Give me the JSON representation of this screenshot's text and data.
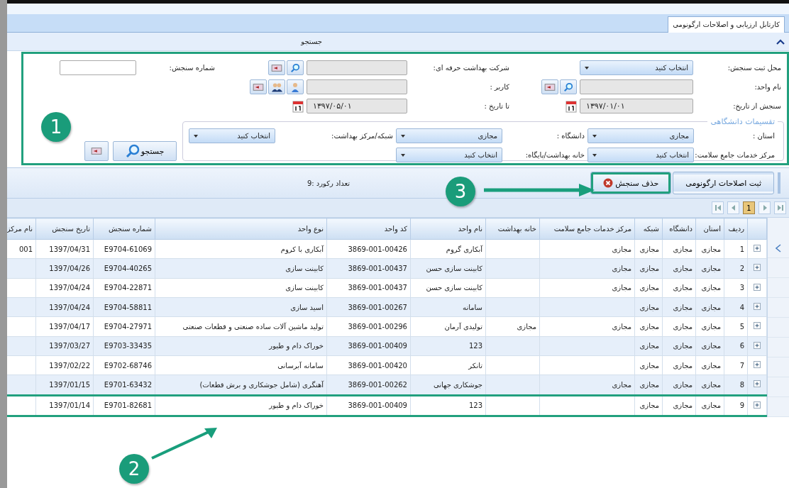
{
  "tab": {
    "label": "کارتابل ارزیابی و اصلاحات ارگونومی",
    "selected": true
  },
  "search_panel": {
    "title": "جستجو",
    "expanded": true,
    "outlined": true,
    "fields": [
      {
        "kind": "select",
        "label": "محل ثبت سنجش:",
        "value": "انتخاب کنید"
      },
      {
        "kind": "lookup",
        "label": "شرکت بهداشت حرفه ای:"
      },
      {
        "kind": "text",
        "label": "شماره سنجش:"
      },
      {
        "kind": "lookup",
        "label": "نام واحد:"
      },
      {
        "kind": "user",
        "label": "کاربر :"
      },
      {
        "kind": "empty"
      },
      {
        "kind": "date",
        "label": "سنجش از تاریخ:",
        "value": "۱۳۹۷/۰۱/۰۱"
      },
      {
        "kind": "date",
        "label": "تا تاریخ :",
        "value": "۱۳۹۷/۰۵/۰۱"
      }
    ],
    "division": {
      "title": "تقسیمات دانشگاهی",
      "fields": [
        {
          "label": "استان :",
          "value": "مجازی"
        },
        {
          "label": "دانشگاه :",
          "value": "مجازی"
        },
        {
          "label": "شبکه/مرکز بهداشت:",
          "value": "انتخاب کنید"
        },
        {
          "label": "مرکز خدمات جامع سلامت:",
          "value": "انتخاب کنید"
        },
        {
          "label": "خانه بهداشت/پایگاه:",
          "value": "انتخاب کنید"
        }
      ]
    },
    "search_button": "جستجو"
  },
  "toolbar": {
    "buttons": [
      {
        "label": "ثبت اصلاحات ارگونومی",
        "kind": "plain",
        "outlined": false
      },
      {
        "label": "حذف سنجش",
        "kind": "delete",
        "outlined": true
      }
    ],
    "record_count": "تعداد رکورد :9"
  },
  "pager": {
    "pages": [
      {
        "label": "1",
        "selected": true
      }
    ]
  },
  "table": {
    "columns": [
      "ردیف",
      "استان",
      "دانشگاه",
      "شبکه",
      "مرکز خدمات جامع سلامت",
      "خانه بهداشت",
      "نام واحد",
      "کد واحد",
      "نوع واحد",
      "شماره سنجش",
      "تاریخ سنجش",
      "نام مرکز"
    ],
    "rows": [
      {
        "current": true,
        "outlined": false,
        "cells": [
          "1",
          "مجازی",
          "مجازی",
          "مجازی",
          "مجازی",
          null,
          "آبکاری گروم",
          "3869-001-00426",
          "آبکاری با کروم",
          "E9704-61069",
          "1397/04/31",
          "001"
        ]
      },
      {
        "current": false,
        "outlined": false,
        "cells": [
          "2",
          "مجازی",
          "مجازی",
          "مجازی",
          "مجازی",
          null,
          "کابینت سازی حسن",
          "3869-001-00437",
          "کابینت سازی",
          "E9704-40265",
          "1397/04/26",
          null
        ]
      },
      {
        "current": false,
        "outlined": false,
        "cells": [
          "3",
          "مجازی",
          "مجازی",
          "مجازی",
          "مجازی",
          null,
          "کابینت سازی حسن",
          "3869-001-00437",
          "کابینت سازی",
          "E9704-22871",
          "1397/04/24",
          null
        ]
      },
      {
        "current": false,
        "outlined": false,
        "cells": [
          "4",
          "مجازی",
          "مجازی",
          "مجازی",
          null,
          null,
          "سامانه",
          "3869-001-00267",
          "اسید سازی",
          "E9704-58811",
          "1397/04/24",
          null
        ]
      },
      {
        "current": false,
        "outlined": false,
        "cells": [
          "5",
          "مجازی",
          "مجازی",
          "مجازی",
          "مجازی",
          "مجازی",
          "تولیدی آرمان",
          "3869-001-00296",
          "تولید ماشین آلات ساده صنعتی و قطعات صنعتی",
          "E9704-27971",
          "1397/04/17",
          null
        ]
      },
      {
        "current": false,
        "outlined": false,
        "cells": [
          "6",
          "مجازی",
          "مجازی",
          "مجازی",
          null,
          null,
          "123",
          "3869-001-00409",
          "خوراک دام و طیور",
          "E9703-33435",
          "1397/03/27",
          null
        ]
      },
      {
        "current": false,
        "outlined": false,
        "cells": [
          "7",
          "مجازی",
          "مجازی",
          "مجازی",
          null,
          null,
          "تانکر",
          "3869-001-00420",
          "سامانه آبرسانی",
          "E9702-68746",
          "1397/02/22",
          null
        ]
      },
      {
        "current": false,
        "outlined": false,
        "cells": [
          "8",
          "مجازی",
          "مجازی",
          "مجازی",
          "مجازی",
          null,
          "جوشکاری جهانی",
          "3869-001-00262",
          "آهنگری (شامل جوشکاری و برش قطعات)",
          "E9701-63432",
          "1397/01/15",
          null
        ]
      },
      {
        "current": false,
        "outlined": true,
        "cells": [
          "9",
          "مجازی",
          "مجازی",
          "مجازی",
          null,
          null,
          "123",
          "3869-001-00409",
          "خوراک دام و طیور",
          "E9701-82681",
          "1397/01/14",
          null
        ]
      }
    ]
  },
  "callouts": [
    {
      "number": "1"
    },
    {
      "number": "2"
    },
    {
      "number": "3"
    }
  ]
}
